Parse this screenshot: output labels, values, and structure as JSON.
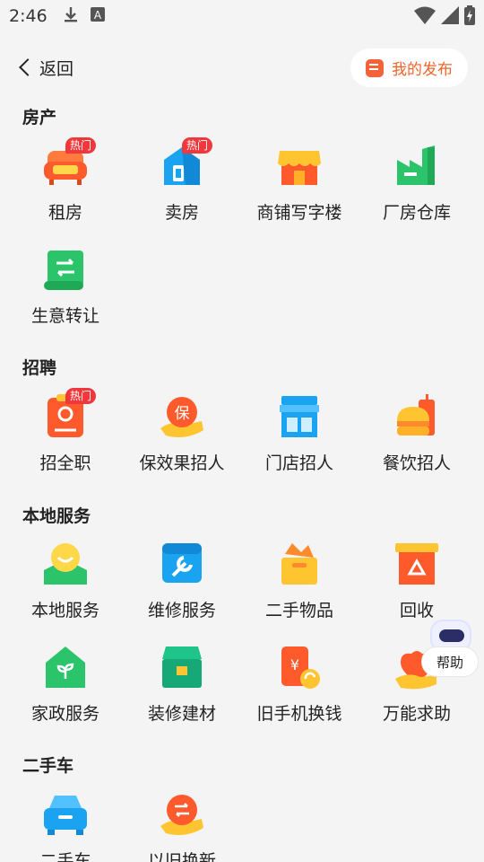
{
  "status_bar": {
    "time": "2:46",
    "battery_icon": "battery-charging-icon",
    "wifi_icon": "wifi-icon",
    "signal_icon": "signal-icon"
  },
  "header": {
    "back_label": "返回",
    "publish_label": "我的发布"
  },
  "hot_badge": "热门",
  "colors": {
    "accent": "#f0642a",
    "badge": "#f0373b"
  },
  "sections": [
    {
      "title": "房产",
      "items": [
        {
          "label": "租房",
          "icon": "sofa-icon",
          "hot": true
        },
        {
          "label": "卖房",
          "icon": "house-icon",
          "hot": true
        },
        {
          "label": "商铺写字楼",
          "icon": "shop-icon",
          "hot": false
        },
        {
          "label": "厂房仓库",
          "icon": "factory-icon",
          "hot": false
        },
        {
          "label": "生意转让",
          "icon": "transfer-icon",
          "hot": false
        }
      ]
    },
    {
      "title": "招聘",
      "items": [
        {
          "label": "招全职",
          "icon": "employee-badge-icon",
          "hot": true
        },
        {
          "label": "保效果招人",
          "icon": "guarantee-icon",
          "hot": false
        },
        {
          "label": "门店招人",
          "icon": "store-icon",
          "hot": false
        },
        {
          "label": "餐饮招人",
          "icon": "burger-icon",
          "hot": false
        }
      ]
    },
    {
      "title": "本地服务",
      "items": [
        {
          "label": "本地服务",
          "icon": "map-pin-icon",
          "hot": false
        },
        {
          "label": "维修服务",
          "icon": "wrench-icon",
          "hot": false
        },
        {
          "label": "二手物品",
          "icon": "box-icon",
          "hot": false
        },
        {
          "label": "回收",
          "icon": "recycle-icon",
          "hot": false
        },
        {
          "label": "家政服务",
          "icon": "home-care-icon",
          "hot": false
        },
        {
          "label": "装修建材",
          "icon": "toolbox-icon",
          "hot": false
        },
        {
          "label": "旧手机换钱",
          "icon": "phone-cash-icon",
          "hot": false
        },
        {
          "label": "万能求助",
          "icon": "help-hand-icon",
          "hot": false
        }
      ]
    },
    {
      "title": "二手车",
      "items": [
        {
          "label": "二手车",
          "icon": "car-icon",
          "hot": false
        },
        {
          "label": "以旧换新",
          "icon": "trade-in-icon",
          "hot": false
        }
      ]
    }
  ],
  "helper": {
    "label": "帮助",
    "icon": "robot-icon"
  }
}
